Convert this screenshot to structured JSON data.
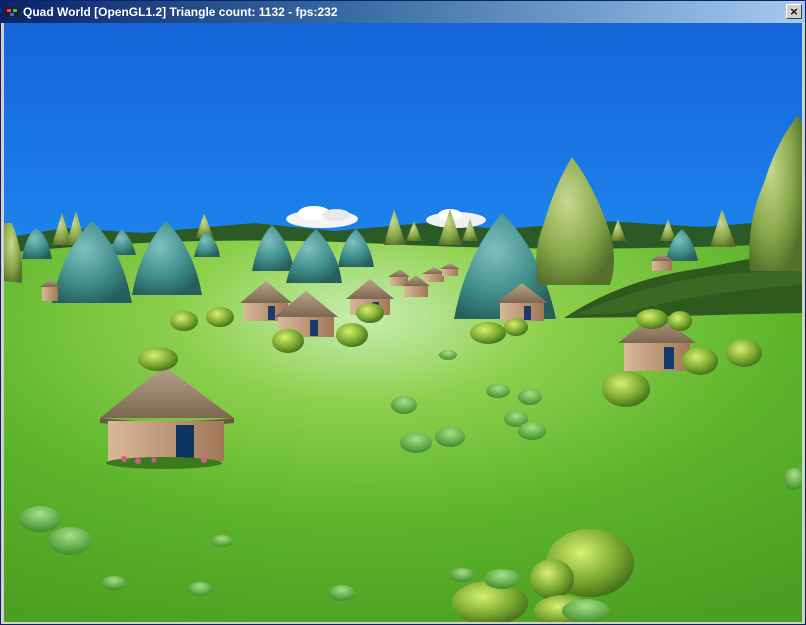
{
  "window": {
    "title": "Quad World [OpenGL1.2] Triangle count: 1132 - fps:232",
    "close_label": "×",
    "icon": "opengl-app-icon"
  },
  "scene": {
    "type": "3d-rendered-village-landscape",
    "sky_color": "#1e78e6",
    "grass_color": "#5fb52a",
    "elements": [
      "sky",
      "distant-hills",
      "clouds",
      "conifer-trees",
      "thatched-huts",
      "shrubs",
      "grass-tufts"
    ]
  }
}
